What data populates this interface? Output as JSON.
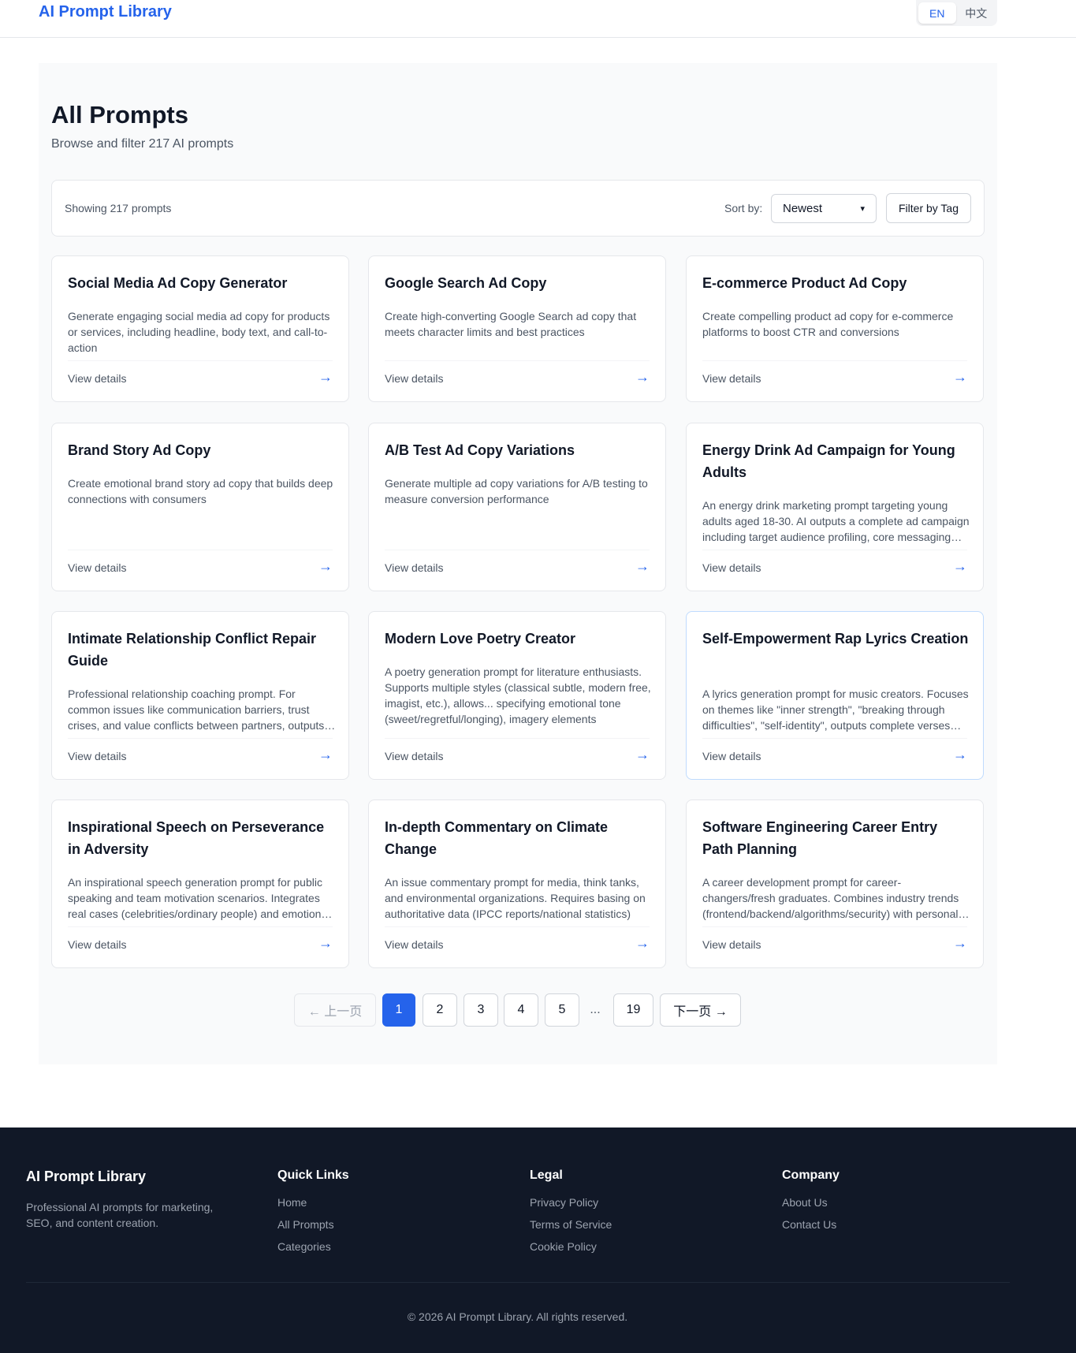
{
  "header": {
    "logo": "AI Prompt Library",
    "languages": [
      {
        "label": "EN",
        "active": true
      },
      {
        "label": "中文",
        "active": false
      }
    ]
  },
  "main": {
    "title": "All Prompts",
    "subtitle": "Browse and filter 217 AI prompts",
    "toolbar": {
      "showing": "Showing 217 prompts",
      "sort_label": "Sort by:",
      "sort_value": "Newest",
      "filter_label": "Filter by Tag"
    },
    "view_details_label": "View details",
    "arrow": "→",
    "cards": [
      {
        "title": "Social Media Ad Copy Generator",
        "desc": "Generate engaging social media ad copy for products or services, including headline, body text, and call-to-action"
      },
      {
        "title": "Google Search Ad Copy",
        "desc": "Create high-converting Google Search ad copy that meets character limits and best practices"
      },
      {
        "title": "E-commerce Product Ad Copy",
        "desc": "Create compelling product ad copy for e-commerce platforms to boost CTR and conversions"
      },
      {
        "title": "Brand Story Ad Copy",
        "desc": "Create emotional brand story ad copy that builds deep connections with consumers"
      },
      {
        "title": "A/B Test Ad Copy Variations",
        "desc": "Generate multiple ad copy variations for A/B testing to measure conversion performance"
      },
      {
        "title": "Energy Drink Ad Campaign for Young Adults",
        "desc": "An energy drink marketing prompt targeting young adults aged 18-30. AI outputs a complete ad campaign including target audience profiling, core messaging and channel strategy"
      },
      {
        "title": "Intimate Relationship Conflict Repair Guide",
        "desc": "Professional relationship coaching prompt. For common issues like communication barriers, trust crises, and value conflicts between partners, outputs step-by-step repair plans"
      },
      {
        "title": "Modern Love Poetry Creator",
        "desc": "A poetry generation prompt for literature enthusiasts. Supports multiple styles (classical subtle, modern free, imagist, etc.), allows... specifying emotional tone (sweet/regretful/longing), imagery elements"
      },
      {
        "title": "Self-Empowerment Rap Lyrics Creation",
        "desc": "A lyrics generation prompt for music creators. Focuses on themes like \"inner strength\", \"breaking through difficulties\", \"self-identity\", outputs complete verses and hooks"
      },
      {
        "title": "Inspirational Speech on Perseverance in Adversity",
        "desc": "An inspirational speech generation prompt for public speaking and team motivation scenarios. Integrates real cases (celebrities/ordinary people) and emotional storytelling"
      },
      {
        "title": "In-depth Commentary on Climate Change",
        "desc": "An issue commentary prompt for media, think tanks, and environmental organizations. Requires basing on authoritative data (IPCC reports/national statistics)"
      },
      {
        "title": "Software Engineering Career Entry Path Planning",
        "desc": "A career development prompt for career-changers/fresh graduates. Combines industry trends (frontend/backend/algorithms/security) with personal skill assessment"
      }
    ],
    "pagination": {
      "prev": "← 上一页",
      "pages": [
        "1",
        "2",
        "3",
        "4",
        "5"
      ],
      "ellipsis": "...",
      "last": "19",
      "next": "下一页 →",
      "current": 1
    }
  },
  "footer": {
    "brand": "AI Prompt Library",
    "tagline": "Professional AI prompts for marketing, SEO, and content creation.",
    "columns": [
      {
        "title": "Quick Links",
        "links": [
          "Home",
          "All Prompts",
          "Categories"
        ]
      },
      {
        "title": "Legal",
        "links": [
          "Privacy Policy",
          "Terms of Service",
          "Cookie Policy"
        ]
      },
      {
        "title": "Company",
        "links": [
          "About Us",
          "Contact Us"
        ]
      }
    ],
    "copyright": "© 2026 AI Prompt Library. All rights reserved."
  },
  "colors": {
    "accent": "#2563eb",
    "footer_bg": "#111827",
    "panel_bg": "#f9fafb"
  }
}
